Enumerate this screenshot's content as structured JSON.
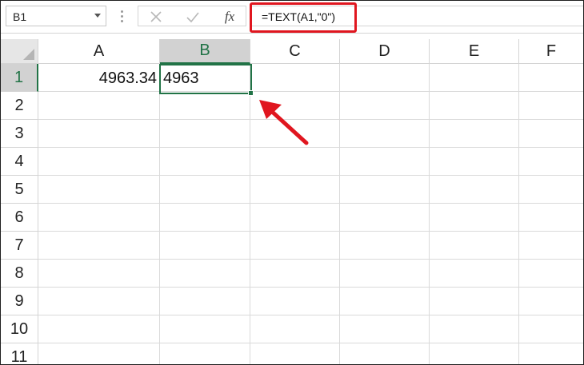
{
  "formula_bar": {
    "name_box": "B1",
    "cancel_icon": "cancel-x-icon",
    "enter_icon": "enter-check-icon",
    "function_icon": "fx-icon",
    "function_label": "fx",
    "formula": "=TEXT(A1,\"0\")"
  },
  "grid": {
    "columns": [
      "A",
      "B",
      "C",
      "D",
      "E",
      "F"
    ],
    "rows": [
      "1",
      "2",
      "3",
      "4",
      "5",
      "6",
      "7",
      "8",
      "9",
      "10",
      "11"
    ],
    "selected_column": "B",
    "selected_row": "1",
    "cells": {
      "A1": "4963.34",
      "B1": "4963"
    }
  },
  "annotations": {
    "highlight_color": "#e0161f",
    "accent_color": "#217346",
    "arrow_icon": "red-arrow-icon"
  }
}
